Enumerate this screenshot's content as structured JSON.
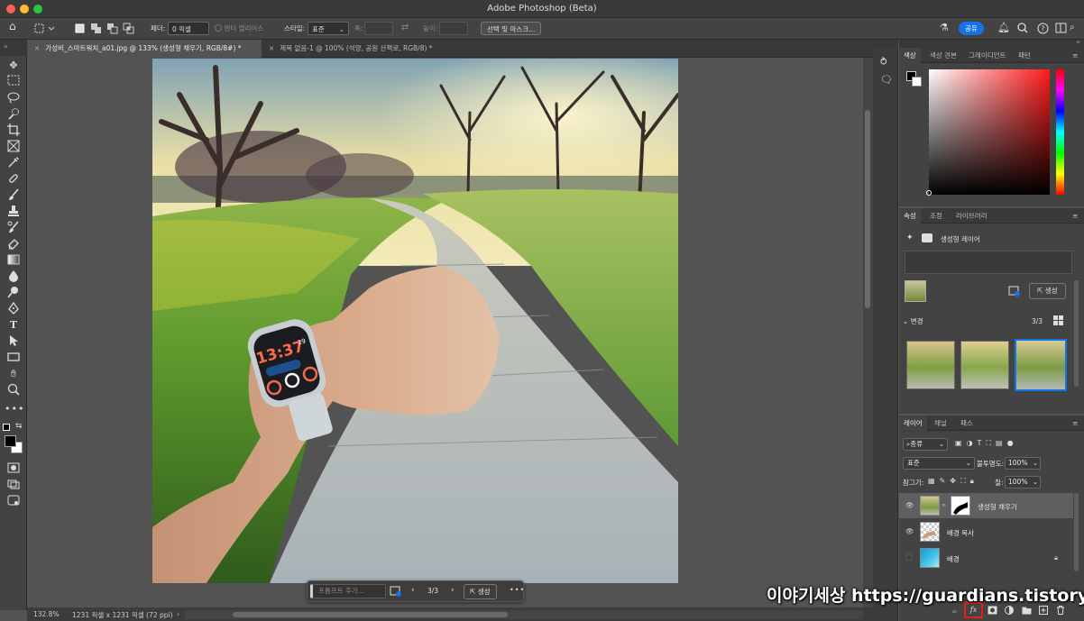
{
  "window": {
    "title": "Adobe Photoshop (Beta)"
  },
  "options_bar": {
    "feather_label": "페더:",
    "feather_value": "0 픽셀",
    "antialias_label": "앤티 앨리어스",
    "style_label": "스타일:",
    "style_value": "표준",
    "width_label": "폭:",
    "height_label": "높이:",
    "select_mask_button": "선택 및 마스크...",
    "share_button": "공유"
  },
  "document_tabs": [
    {
      "label": "가성비_스마트워치_a01.jpg @ 133% (생성형 채우기, RGB/8#) *"
    },
    {
      "label": "제목 없음-1 @ 100% (석양, 공원 산책로, RGB/8) *"
    }
  ],
  "status_bar": {
    "zoom": "132.8%",
    "doc_info": "1231 픽셀 x 1231 픽셀 (72 ppi)"
  },
  "contextual_bar": {
    "prompt_placeholder": "프롬프트 추가...",
    "variation_counter": "3/3",
    "generate_button": "생성"
  },
  "color_panel": {
    "tabs": [
      "색상",
      "색상 견본",
      "그레이디언트",
      "패턴"
    ],
    "hue_color": "#ff1a1a"
  },
  "properties_panel": {
    "tabs": [
      "속성",
      "조정",
      "라이브러리"
    ],
    "layer_type": "생성형 레이어",
    "generate_button": "생성",
    "variations_label": "변경",
    "variations_counter": "3/3"
  },
  "layers_panel": {
    "tabs": [
      "레이어",
      "채널",
      "패스"
    ],
    "filter_kind": "종류",
    "blend_mode": "표준",
    "opacity_label": "불투명도:",
    "opacity_value": "100%",
    "lock_label": "잠그기:",
    "fill_label": "칠:",
    "fill_value": "100%",
    "layers": [
      {
        "name": "생성형 채우기",
        "visible": true,
        "selected": true
      },
      {
        "name": "배경 복사",
        "visible": true,
        "selected": false
      },
      {
        "name": "배경",
        "visible": false,
        "selected": false
      }
    ]
  },
  "watermark": "이야기세상 https://guardians.tistory.com",
  "watch": {
    "time": "13:37",
    "date": "29"
  },
  "colors": {
    "accent": "#1473e6",
    "highlight_box": "#e0201b"
  }
}
